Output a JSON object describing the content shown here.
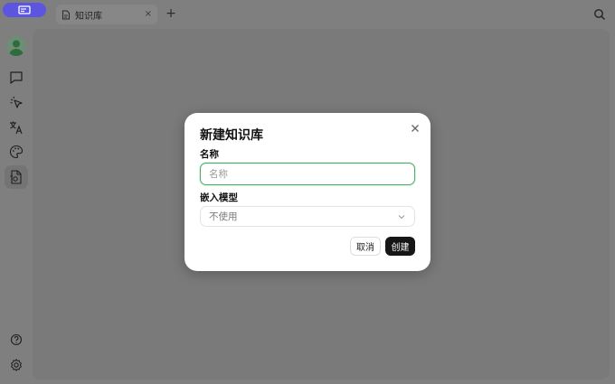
{
  "tabs": [
    {
      "label": "知识库",
      "icon": "document-icon",
      "close": "×"
    }
  ],
  "new_tab": "+",
  "sidebar": {
    "top_items": [
      {
        "icon": "avatar"
      },
      {
        "icon": "chat-icon"
      },
      {
        "icon": "cursor-sparkle-icon"
      },
      {
        "icon": "translate-icon"
      },
      {
        "icon": "palette-icon"
      },
      {
        "icon": "knowledge-base-icon",
        "active": true
      }
    ],
    "bottom_items": [
      {
        "icon": "help-icon"
      },
      {
        "icon": "settings-icon"
      }
    ]
  },
  "dialog": {
    "title": "新建知识库",
    "name_label": "名称",
    "name_placeholder": "名称",
    "embed_label": "嵌入模型",
    "embed_value": "不使用",
    "cancel": "取消",
    "create": "创建"
  },
  "colors": {
    "accent": "#5b55e0",
    "focus": "#4caf65",
    "primary_button": "#161616"
  }
}
